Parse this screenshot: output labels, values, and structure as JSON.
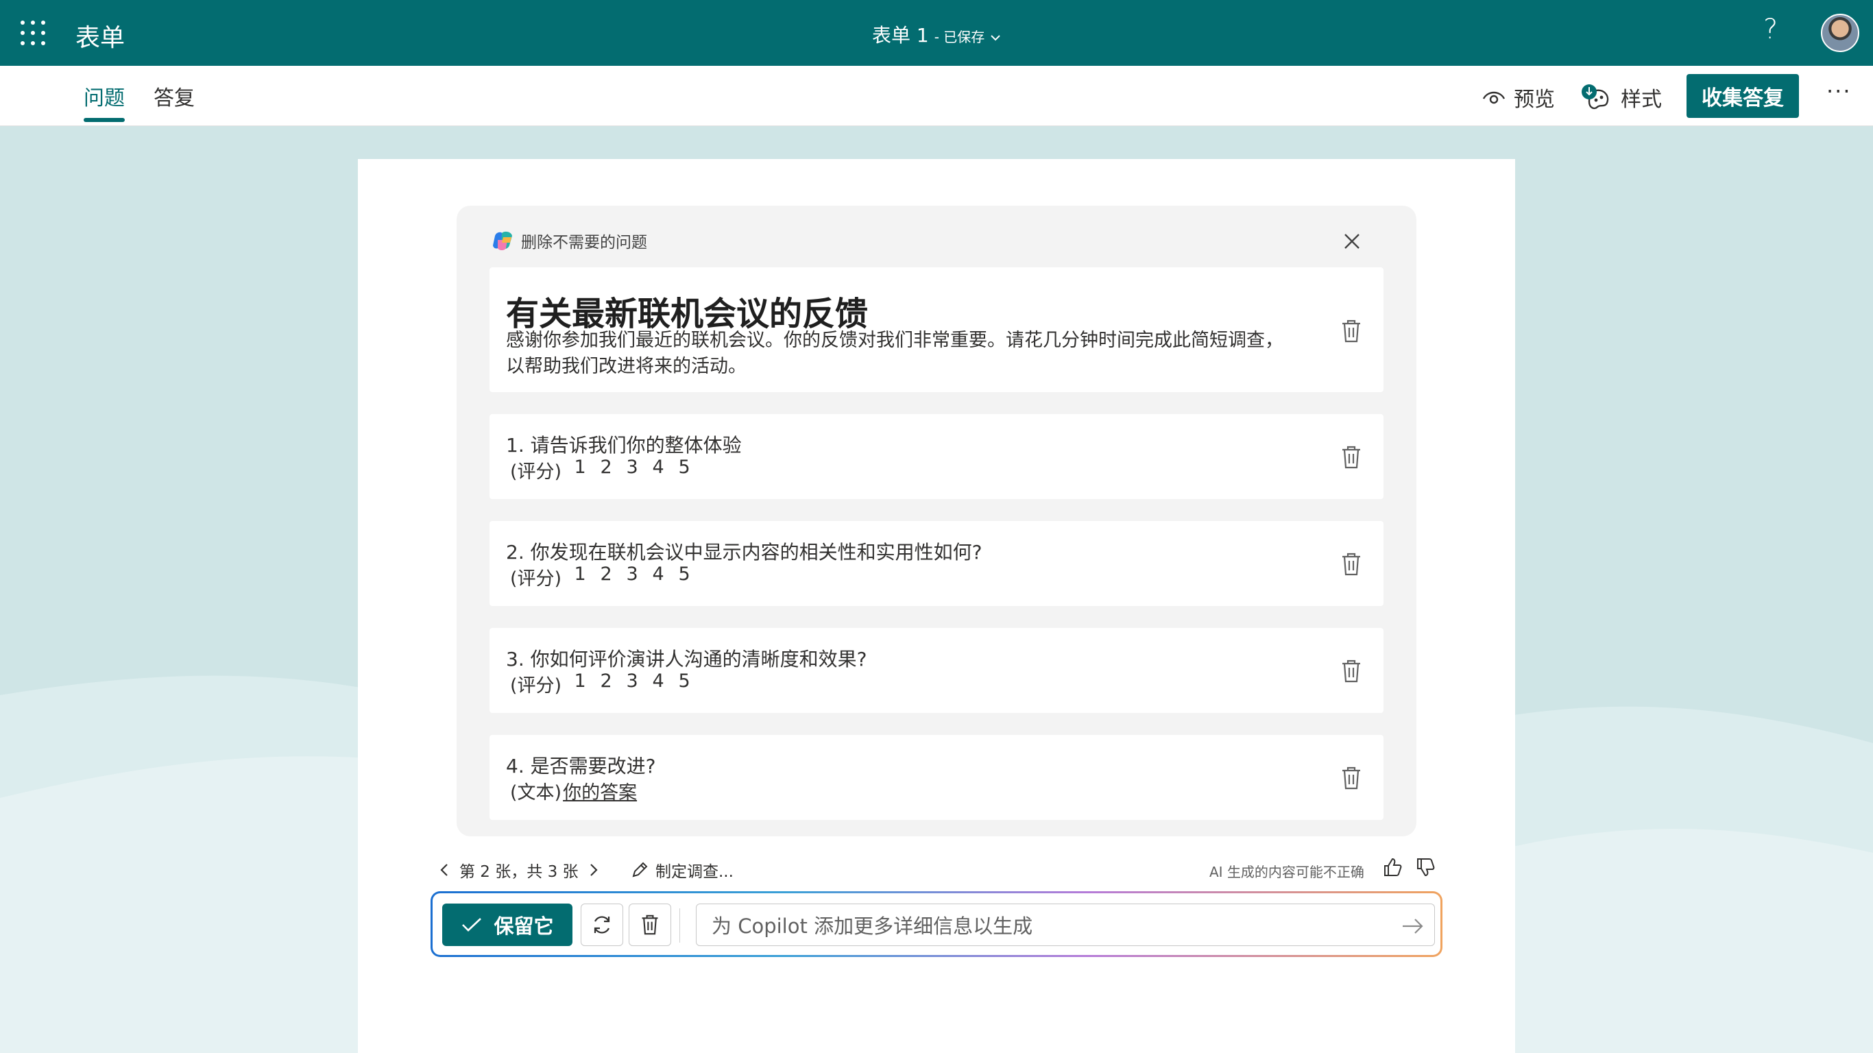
{
  "header": {
    "app_name": "表单",
    "doc_title": "表单 1",
    "save_status": "- 已保存",
    "help": "?"
  },
  "tabs": [
    {
      "label": "问题",
      "active": true
    },
    {
      "label": "答复",
      "active": false
    }
  ],
  "commands": {
    "preview": "预览",
    "style": "样式",
    "collect": "收集答复",
    "more": "···"
  },
  "panel": {
    "header": "删除不需要的问题",
    "form_title": "有关最新联机会议的反馈",
    "form_description_line1": "感谢你参加我们最近的联机会议。你的反馈对我们非常重要。请花几分钟时间完成此简短调查，",
    "form_description_line2": "以帮助我们改进将来的活动。",
    "questions": [
      {
        "text": "1. 请告诉我们你的整体体验",
        "type": "(评分)",
        "scale": [
          "1",
          "2",
          "3",
          "4",
          "5"
        ]
      },
      {
        "text": "2. 你发现在联机会议中显示内容的相关性和实用性如何?",
        "type": "(评分)",
        "scale": [
          "1",
          "2",
          "3",
          "4",
          "5"
        ]
      },
      {
        "text": "3. 你如何评价演讲人沟通的清晰度和效果?",
        "type": "(评分)",
        "scale": [
          "1",
          "2",
          "3",
          "4",
          "5"
        ]
      },
      {
        "text": "4. 是否需要改进?",
        "type": "(文本)",
        "placeholder": "你的答案"
      }
    ]
  },
  "footer": {
    "pager": "第 2 张，共 3 张",
    "draft": "制定调查...",
    "ai_note": "AI 生成的内容可能不正确"
  },
  "composer": {
    "keep_label": "保留它",
    "prompt_placeholder": "为 Copilot 添加更多详细信息以生成"
  },
  "colors": {
    "brand": "#036c70",
    "background": "#cfe5e6"
  }
}
